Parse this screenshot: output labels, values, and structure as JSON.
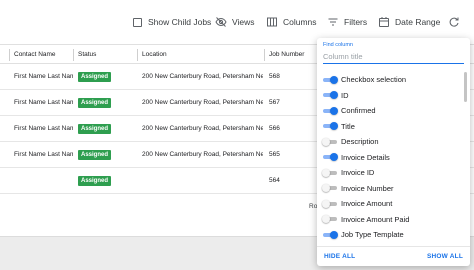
{
  "toolbar": {
    "show_child_jobs": "Show Child Jobs",
    "views": "Views",
    "columns": "Columns",
    "filters": "Filters",
    "date_range": "Date Range"
  },
  "table": {
    "headers": [
      "Contact Name",
      "Status",
      "Location",
      "Job Number"
    ],
    "rows": [
      {
        "contact": "First Name Last Nam",
        "status": "Assigned",
        "location": "200 New Canterbury Road, Petersham New",
        "job": "568"
      },
      {
        "contact": "First Name Last Nam",
        "status": "Assigned",
        "location": "200 New Canterbury Road, Petersham New",
        "job": "567"
      },
      {
        "contact": "First Name Last Nam",
        "status": "Assigned",
        "location": "200 New Canterbury Road, Petersham New",
        "job": "566"
      },
      {
        "contact": "First Name Last Nam",
        "status": "Assigned",
        "location": "200 New Canterbury Road, Petersham New",
        "job": "565"
      },
      {
        "contact": "",
        "status": "Assigned",
        "location": "",
        "job": "564"
      }
    ],
    "footer_partial": "Ro"
  },
  "column_panel": {
    "find_label": "Find column",
    "find_placeholder": "Column title",
    "items": [
      {
        "label": "Checkbox selection",
        "on": true
      },
      {
        "label": "ID",
        "on": true
      },
      {
        "label": "Confirmed",
        "on": true
      },
      {
        "label": "Title",
        "on": true
      },
      {
        "label": "Description",
        "on": false
      },
      {
        "label": "Invoice Details",
        "on": true
      },
      {
        "label": "Invoice ID",
        "on": false
      },
      {
        "label": "Invoice Number",
        "on": false
      },
      {
        "label": "Invoice Amount",
        "on": false
      },
      {
        "label": "Invoice Amount Paid",
        "on": false
      },
      {
        "label": "Job Type Template",
        "on": true
      }
    ],
    "hide_all": "HIDE ALL",
    "show_all": "SHOW ALL"
  },
  "colors": {
    "accent": "#1a73e8",
    "status_assigned": "#2e9e4f"
  }
}
